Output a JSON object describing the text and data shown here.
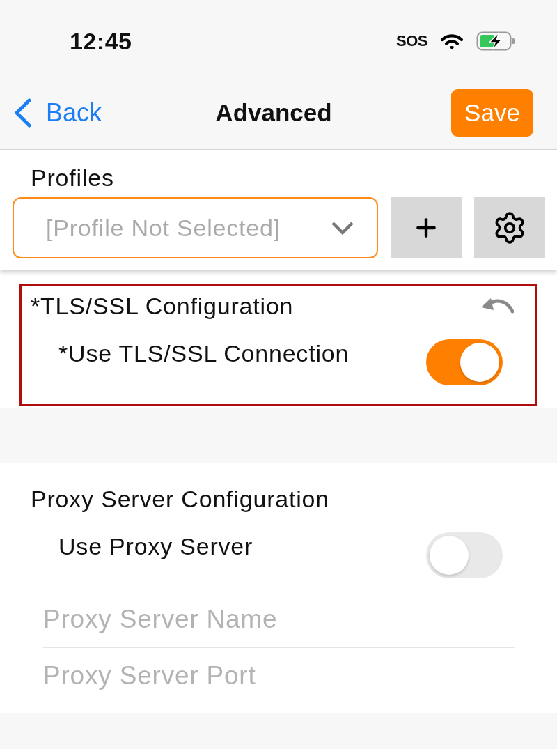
{
  "status_bar": {
    "time": "12:45",
    "cellular": "SOS"
  },
  "nav_bar": {
    "back": "Back",
    "title": "Advanced",
    "save": "Save"
  },
  "profiles": {
    "label": "Profiles",
    "select": {
      "placeholder": "[Profile Not Selected]"
    },
    "buttons": [
      {
        "kind": "add"
      },
      {
        "kind": "settings"
      }
    ]
  },
  "sections": [
    {
      "title": "*TLS/SSL Configuration",
      "highlighted": true,
      "revert": true,
      "items": [
        {
          "kind": "toggle",
          "label": "*Use TLS/SSL Connection",
          "on": true
        }
      ]
    },
    {
      "title": "Proxy Server Configuration",
      "highlighted": false,
      "revert": false,
      "items": [
        {
          "kind": "toggle",
          "label": "Use Proxy Server",
          "on": false
        },
        {
          "kind": "field",
          "placeholder": "Proxy Server Name"
        },
        {
          "kind": "field",
          "placeholder": "Proxy Server Port"
        }
      ]
    }
  ]
}
